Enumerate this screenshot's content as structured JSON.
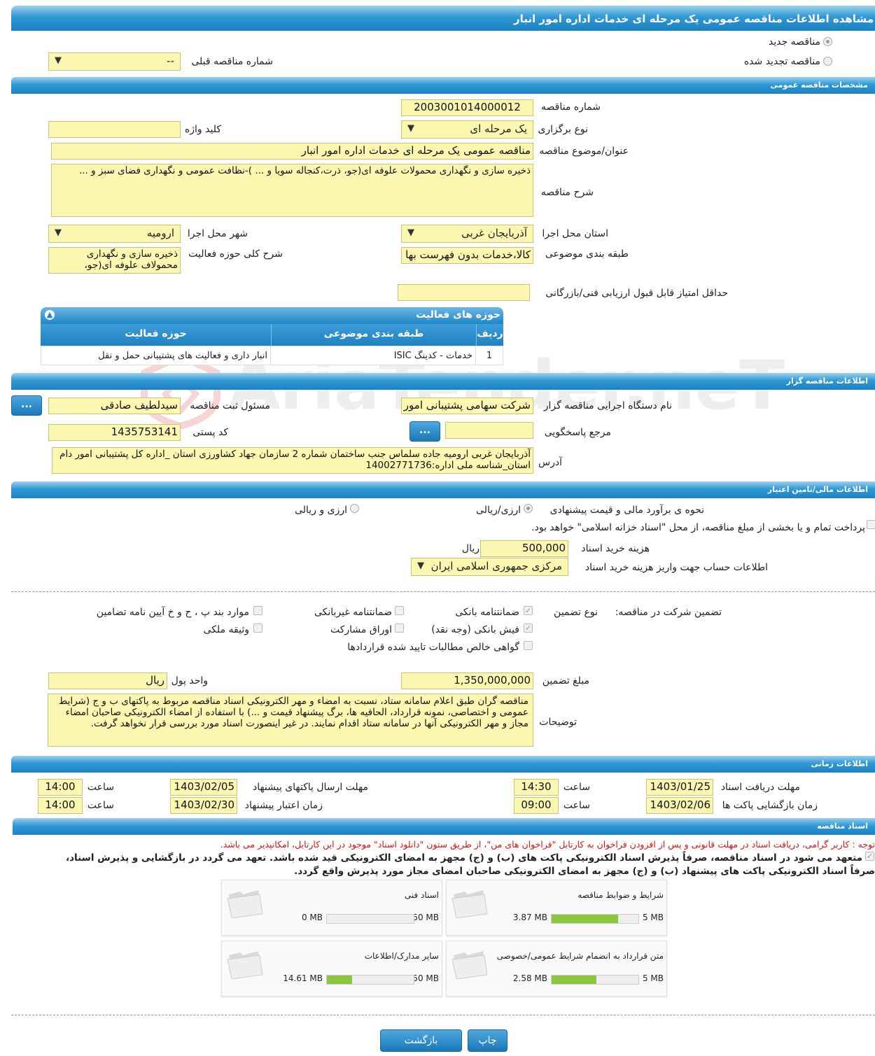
{
  "header": {
    "title": "مشاهده اطلاعات مناقصه عمومی یک مرحله ای خدمات اداره امور انبار"
  },
  "top": {
    "new_tender": "مناقصه جدید",
    "renewed_tender": "مناقصه تجدید شده",
    "prev_number_label": "شماره مناقصه قبلی",
    "prev_number_value": "--"
  },
  "general": {
    "section": "مشخصات مناقصه عمومی",
    "number_label": "شماره مناقصه",
    "number_value": "2003001014000012",
    "type_label": "نوع برگزاری",
    "type_value": "یک مرحله ای",
    "keyword_label": "کلید واژه",
    "keyword_value": "",
    "subject_label": "عنوان/موضوع مناقصه",
    "subject_value": "مناقصه عمومی یک مرحله ای خدمات اداره امور انبار",
    "desc_label": "شرح مناقصه",
    "desc_value": "ذخیره سازی و نگهداری محمولات علوفه ای(جو، ذرت،کنجاله سویا و ... )-نظافت عمومی و نگهداری فضای سبز و ...",
    "province_label": "استان محل اجرا",
    "province_value": "آذربایجان غربی",
    "city_label": "شهر محل اجرا",
    "city_value": "ارومیه",
    "category_label": "طبقه بندی موضوعی",
    "category_value": "کالا،خدمات بدون فهرست بها",
    "scope_label": "شرح کلی حوزه فعالیت",
    "scope_value": "ذخیره سازی و نگهداری محمولاف علوفه ای(جو،",
    "min_score_label": "حداقل امتیاز قابل قبول ارزیابی فنی/بازرگانی",
    "min_score_value": ""
  },
  "activities": {
    "title": "حوزه های فعالیت",
    "cols": [
      "ردیف",
      "طبقه بندی موضوعی",
      "حوزه فعالیت"
    ],
    "rows": [
      {
        "idx": "1",
        "cat": "خدمات - کدینگ ISIC",
        "scope": "انبار داری و فعالیت های پشتیبانی حمل و نقل"
      }
    ]
  },
  "organizer": {
    "section": "اطلاعات مناقصه گزار",
    "org_label": "نام دستگاه اجرایی مناقصه گزار",
    "org_value": "شرکت سهامی پشتیبانی امور دام",
    "resp_label": "مسئول ثبت مناقصه",
    "resp_value": "سیدلطیف صادقی",
    "ref_label": "مرجع پاسخگویی",
    "ref_value": "",
    "postal_label": "کد پستی",
    "postal_value": "1435753141",
    "addr_label": "آدرس",
    "addr_value": "آذربایجان غربی ارومیه جاده سلماس جنب ساختمان شماره 2 سازمان جهاد کشاورزی استان _اداره کل پشتیبانی امور دام استان_شناسه ملی اداره:14002771736",
    "dots": "..."
  },
  "finance": {
    "section": "اطلاعات مالی/تامین اعتبار",
    "estimate_label": "نحوه ی برآورد مالی و قیمت پیشنهادی",
    "opt_rial": "ارزی/ریالی",
    "opt_fx": "ارزی و ریالی",
    "treasury": "پرداخت تمام و یا بخشی از مبلغ مناقصه، از محل \"اسناد خزانه اسلامی\" خواهد بود.",
    "fee_label": "هزینه خرید اسناد",
    "fee_value": "500,000",
    "fee_unit": "ریال",
    "account_label": "اطلاعات حساب جهت واریز هزینه خرید اسناد",
    "account_value": "مرکزی جمهوری اسلامی ایران"
  },
  "guarantee": {
    "title": "تضمین شرکت در مناقصه:",
    "type_label": "نوع تضمین",
    "bank": "ضمانتنامه بانکی",
    "nonbank": "ضمانتنامه غیربانکی",
    "clauses": "موارد بند پ ، ح و خ آیین نامه تضامین",
    "cash": "فیش بانکی (وجه نقد)",
    "bonds": "اوراق مشارکت",
    "property": "وثیقه ملکی",
    "claims": "گواهی خالص مطالبات تایید شده قراردادها",
    "amount_label": "مبلغ تضمین",
    "amount_value": "1,350,000,000",
    "currency_label": "واحد پول",
    "currency_value": "ریال",
    "notes_label": "توضیحات",
    "notes_value": "مناقصه گران طبق اعلام سامانه ستاد، نسبت به امضاء و مهر الکترونیکی اسناد مناقصه مربوط به پاکتهای ب و ج (شرایط عمومی و اختصاصی، نمونه قرارداد، الحاقیه ها، برگ پیشنهاد قیمت و ...) با استفاده از امضاء الکترونیکی صاحبان امضاء مجاز و مهر الکترونیکی آنها در سامانه ستاد اقدام نمایند. در غیر اینصورت اسناد مورد بررسی قرار نخواهد گرفت."
  },
  "timing": {
    "section": "اطلاعات زمانی",
    "doc_deadline_label": "مهلت دریافت اسناد",
    "doc_deadline_date": "1403/01/25",
    "doc_deadline_time": "14:30",
    "send_deadline_label": "مهلت ارسال پاکتهای پیشنهاد",
    "send_deadline_date": "1403/02/05",
    "send_deadline_time": "14:00",
    "open_label": "زمان بازگشایی پاکت ها",
    "open_date": "1403/02/06",
    "open_time": "09:00",
    "valid_label": "زمان اعتبار پیشنهاد",
    "valid_date": "1403/02/30",
    "valid_time": "14:00",
    "time_label": "ساعت"
  },
  "documents": {
    "section": "اسناد مناقصه",
    "notice": "توجه : کاربر گرامی، دریافت اسناد در مهلت قانونی و پس از افزودن فراخوان به کارتابل \"فراخوان های من\"، از طریق ستون \"دانلود اسناد\" موجود در این کارتابل، امکانپذیر می باشد.",
    "pledge_1": "متعهد می شود در اسناد مناقصه، صرفاً پذیرش اسناد الکترونیکی پاکت های (ب) و (ج) مجهز به امضای الکترونیکی قید شده باشد. تعهد می گردد در بازگشایی و پذیرش اسناد،",
    "pledge_2": "صرفاً اسناد الکترونیکی پاکت های پیشنهاد (ب) و (ج) مجهز به امضای الکترونیکی صاحبان امضای مجاز مورد پذیرش واقع گردد.",
    "items": [
      {
        "title": "شرایط و ضوابط مناقصه",
        "current": "3.87 MB",
        "max": "5 MB",
        "fraction": 0.77
      },
      {
        "title": "اسناد فنی",
        "current": "0 MB",
        "max": "50 MB",
        "fraction": 0.0
      },
      {
        "title": "متن قرارداد به انضمام شرایط عمومی/خصوصی",
        "current": "2.58 MB",
        "max": "5 MB",
        "fraction": 0.52
      },
      {
        "title": "سایر مدارک/اطلاعات",
        "current": "14.61 MB",
        "max": "50 MB",
        "fraction": 0.29
      }
    ]
  },
  "footer": {
    "print": "چاپ",
    "back": "بازگشت"
  },
  "watermark": "AriaTender.neT",
  "colors": {
    "accent": "#1f86c6",
    "field": "#fbf7b0",
    "progress": "#8cc63f",
    "notice": "#dd1111"
  }
}
